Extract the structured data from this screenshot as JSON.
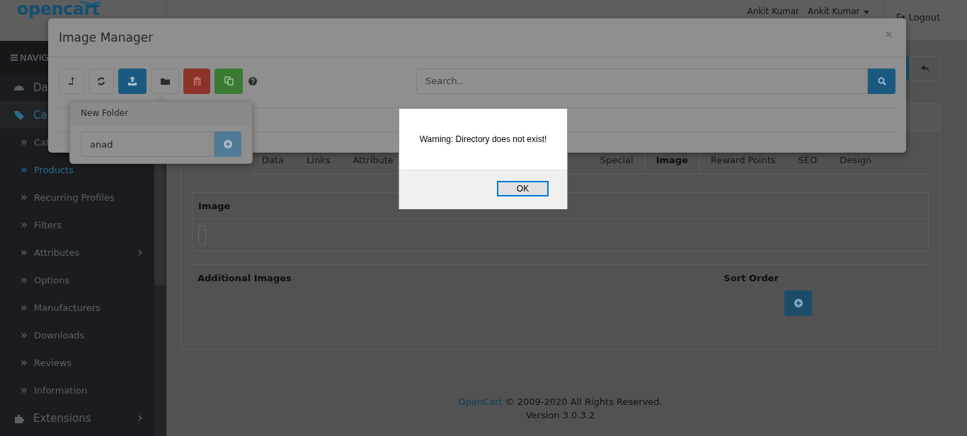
{
  "header": {
    "logo": "opencart",
    "user_names": [
      "Ankit Kumar",
      "Ankit Kumar"
    ],
    "logout": "Logout"
  },
  "sidebar": {
    "heading": "NAVIG",
    "items": [
      {
        "label": "Da",
        "selected": false
      },
      {
        "label": "Ca",
        "selected": true,
        "expandable": false,
        "children": [
          {
            "label": "Cat",
            "selected": false
          },
          {
            "label": "Products",
            "selected": true,
            "expandable": false
          },
          {
            "label": "Recurring Profiles",
            "selected": false,
            "expandable": false
          },
          {
            "label": "Filters",
            "selected": false,
            "expandable": false
          },
          {
            "label": "Attributes",
            "selected": false,
            "expandable": true
          },
          {
            "label": "Options",
            "selected": false,
            "expandable": false
          },
          {
            "label": "Manufacturers",
            "selected": false,
            "expandable": false
          },
          {
            "label": "Downloads",
            "selected": false,
            "expandable": false
          },
          {
            "label": "Reviews",
            "selected": false,
            "expandable": false
          },
          {
            "label": "Information",
            "selected": false,
            "expandable": false
          }
        ]
      },
      {
        "label": "Extensions",
        "selected": false,
        "expandable": true
      }
    ]
  },
  "tabs": [
    {
      "label": "Data",
      "selected": false
    },
    {
      "label": "Links",
      "selected": false
    },
    {
      "label": "Attribute",
      "selected": false
    },
    {
      "label": "Special",
      "selected": false
    },
    {
      "label": "Image",
      "selected": true
    },
    {
      "label": "Reward Points",
      "selected": false
    },
    {
      "label": "SEO",
      "selected": false
    },
    {
      "label": "Design",
      "selected": false
    }
  ],
  "image_table": {
    "heading": "Image"
  },
  "additional_table": {
    "columns": [
      "Additional Images",
      "Sort Order"
    ]
  },
  "footer": {
    "link": "OpenCart",
    "text": "© 2009-2020 All Rights Reserved.",
    "version": "Version 3.0.3.2"
  },
  "image_manager": {
    "title": "Image Manager",
    "search": {
      "placeholder": "Search.."
    }
  },
  "new_folder": {
    "title": "New Folder",
    "value": "anad"
  },
  "alert": {
    "message": "Warning: Directory does not exist!",
    "button": "OK"
  }
}
